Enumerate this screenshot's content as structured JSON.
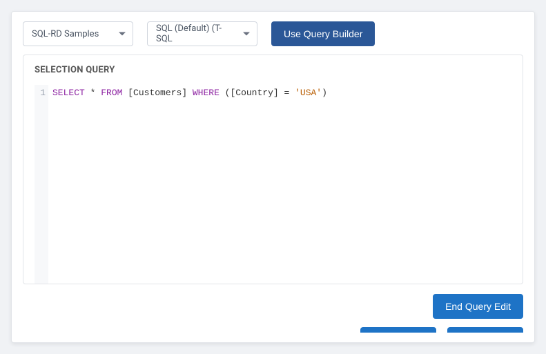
{
  "toolbar": {
    "dropdown1": {
      "label": "SQL-RD Samples"
    },
    "dropdown2": {
      "label": "SQL (Default) (T-SQL"
    },
    "queryBuilder": "Use Query Builder"
  },
  "editor": {
    "title": "SELECTION QUERY",
    "lineNumber": "1",
    "sql": {
      "kw_select": "SELECT",
      "star": " * ",
      "kw_from": "FROM",
      "table": " [Customers] ",
      "kw_where": "WHERE",
      "open": " ([Country] = ",
      "literal": "'USA'",
      "close": ")"
    }
  },
  "footer": {
    "endEdit": "End Query Edit"
  }
}
